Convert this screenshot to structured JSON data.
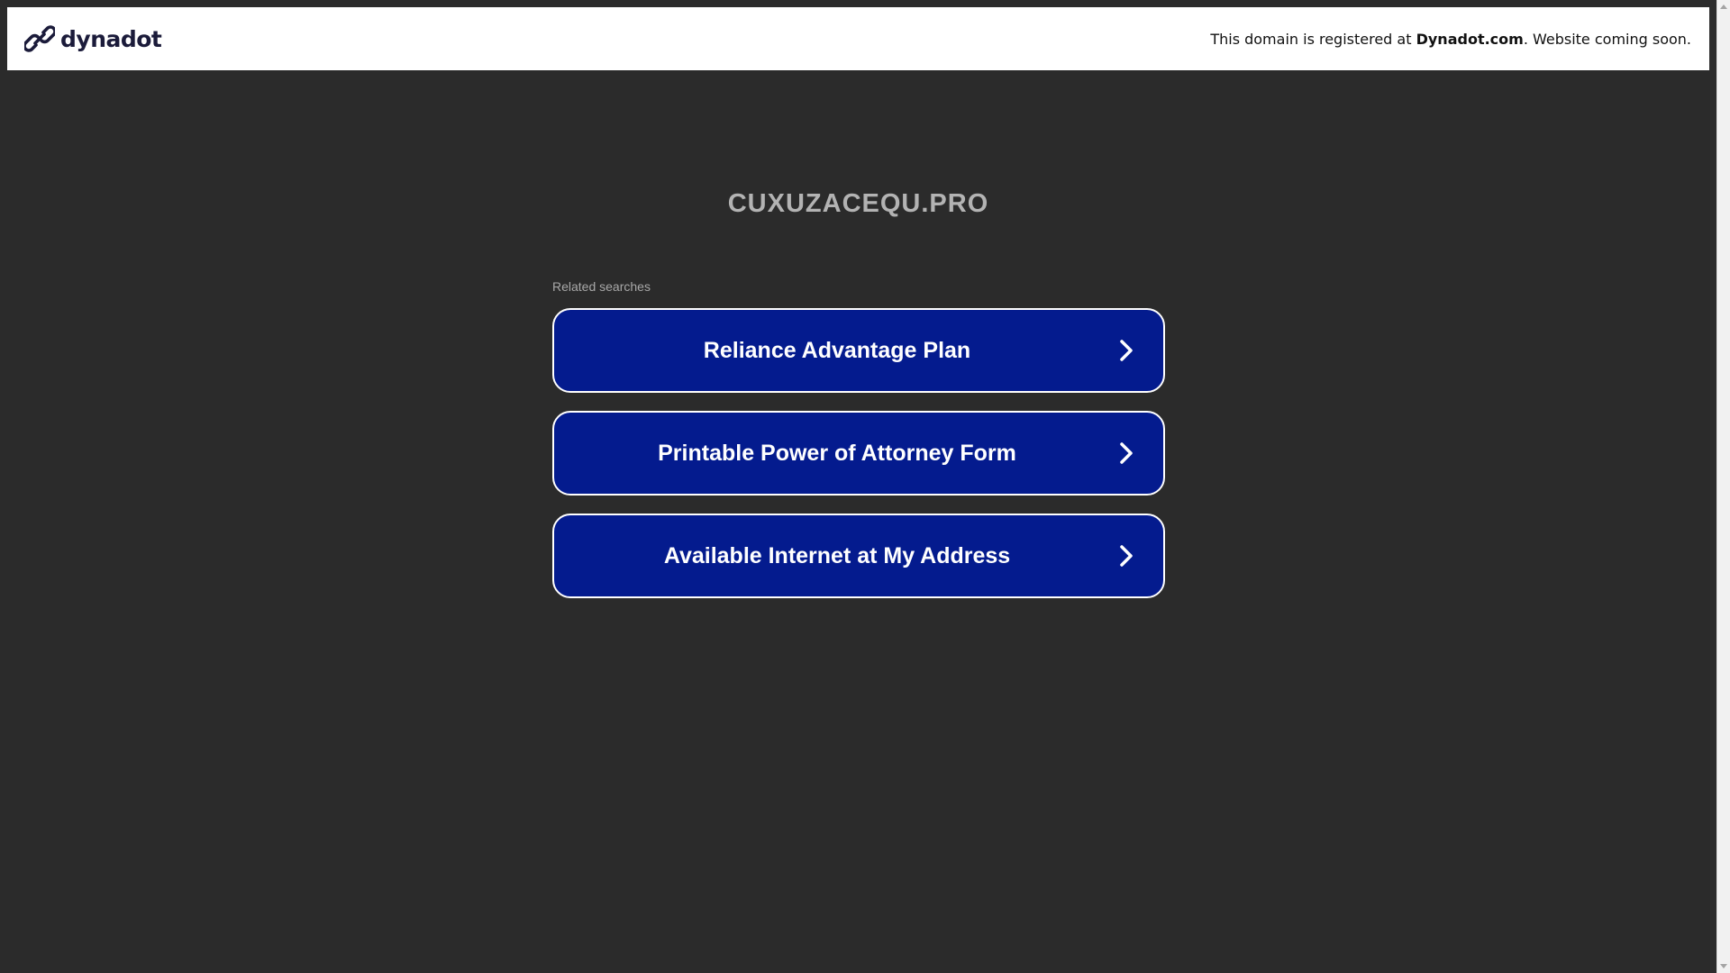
{
  "banner": {
    "logo_text": "dynadot",
    "message_prefix": "This domain is registered at ",
    "message_brand": "Dynadot.com",
    "message_suffix": ". Website coming soon."
  },
  "main": {
    "domain_name": "CUXUZACEQU.PRO",
    "related_label": "Related searches",
    "searches": [
      {
        "label": "Reliance Advantage Plan"
      },
      {
        "label": "Printable Power of Attorney Form"
      },
      {
        "label": "Available Internet at My Address"
      }
    ]
  },
  "colors": {
    "background": "#2b2b2b",
    "banner_bg": "#ffffff",
    "button_bg": "#041b8e",
    "button_border": "#ffffff",
    "title": "#b3b3b3"
  }
}
